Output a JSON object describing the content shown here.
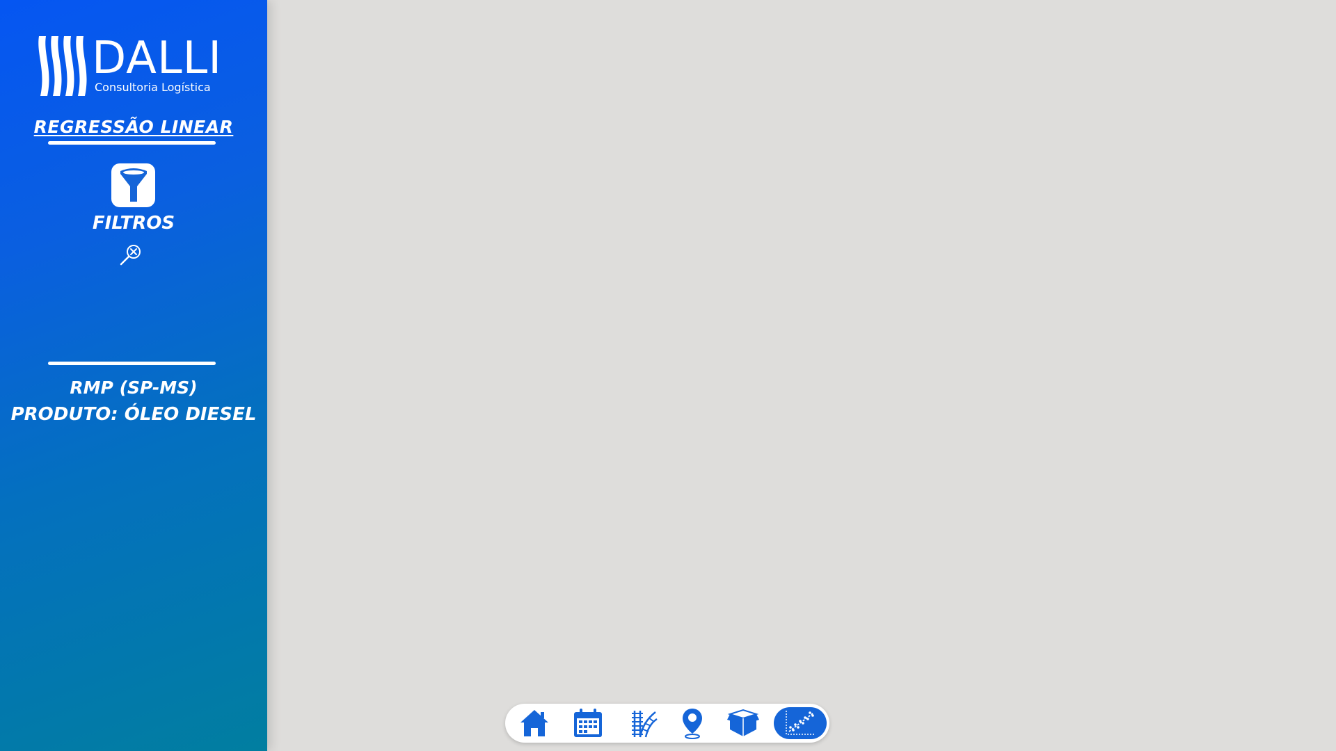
{
  "brand": {
    "name": "DALLI",
    "tagline": "Consultoria Logística"
  },
  "sidebar": {
    "section_title": "REGRESSÃO LINEAR",
    "filter_label": "FILTROS",
    "region": "RMP (SP-MS)",
    "product": "PRODUTO: ÓLEO DIESEL"
  },
  "nav": {
    "items": [
      {
        "icon": "home-icon",
        "active": false
      },
      {
        "icon": "calendar-icon",
        "active": false
      },
      {
        "icon": "railway-icon",
        "active": false
      },
      {
        "icon": "map-pin-icon",
        "active": false
      },
      {
        "icon": "box-icon",
        "active": false
      },
      {
        "icon": "scatter-chart-icon",
        "active": true
      }
    ]
  },
  "colors": {
    "sidebar_top": "#0556f2",
    "sidebar_bottom": "#017ea0",
    "content_bg": "#dedddb",
    "nav_icon": "#1565d8",
    "nav_active_bg": "#1565d8"
  }
}
